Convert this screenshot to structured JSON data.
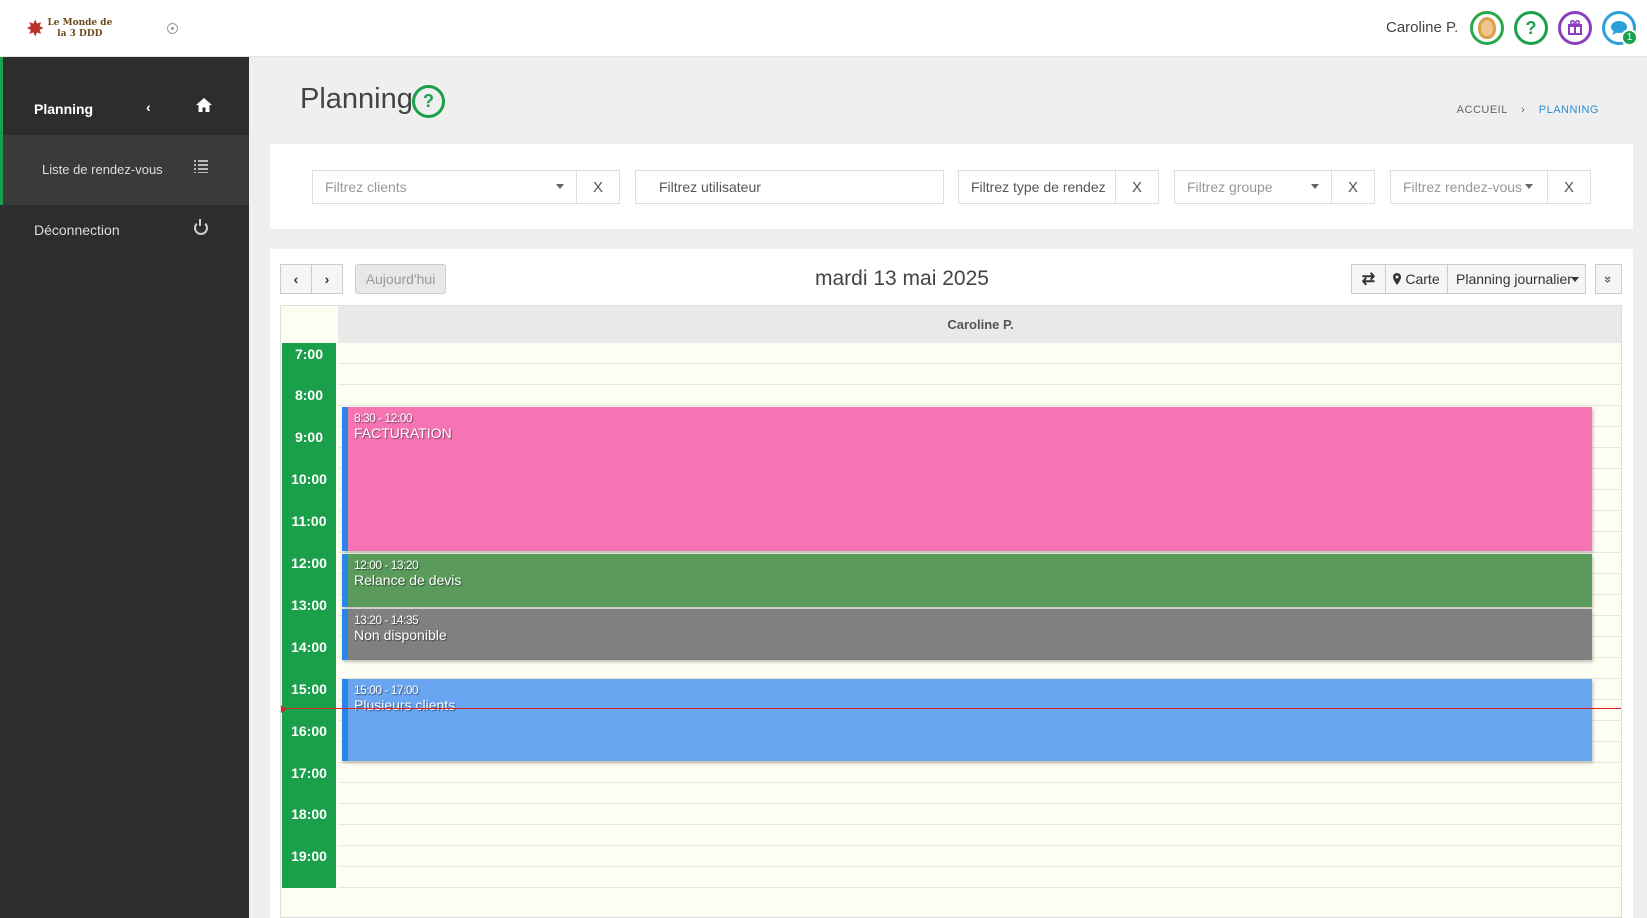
{
  "app": {
    "logo_line1": "Le Monde de",
    "logo_line2": "la 3 DDD"
  },
  "header": {
    "user_name": "Caroline P.",
    "help_glyph": "?",
    "chat_badge": "1",
    "icons": [
      "avatar",
      "help-icon",
      "gift-icon",
      "chat-icon"
    ]
  },
  "sidebar": {
    "planning_label": "Planning",
    "list_label": "Liste de rendez-vous",
    "logout_label": "Déconnection"
  },
  "page": {
    "title": "Planning",
    "help_glyph": "?",
    "breadcrumb_home": "ACCUEIL",
    "breadcrumb_sep": "›",
    "breadcrumb_current": "PLANNING"
  },
  "filters": {
    "clients_placeholder": "Filtrez clients",
    "user_placeholder": "Filtrez utilisateur",
    "type_placeholder": "Filtrez type de rendez",
    "group_placeholder": "Filtrez groupe",
    "appointments_placeholder": "Filtrez rendez-vous",
    "clear_label": "X"
  },
  "calendar": {
    "prev": "‹",
    "next": "›",
    "today_label": "Aujourd'hui",
    "date_title": "mardi 13 mai 2025",
    "swap_icon": "⇄",
    "map_label": "Carte",
    "view_label": "Planning journalier",
    "more_icon": "»",
    "column_user": "Caroline P.",
    "hours": [
      "7:00",
      "8:00",
      "9:00",
      "10:00",
      "11:00",
      "12:00",
      "13:00",
      "14:00",
      "15:00",
      "16:00",
      "17:00",
      "18:00",
      "19:00"
    ],
    "events": [
      {
        "time": "8:30 - 12:00",
        "title": "FACTURATION",
        "color": "#f674b3"
      },
      {
        "time": "12:00 - 13:20",
        "title": "Relance de devis",
        "color": "#5a9a5a"
      },
      {
        "time": "13:20 - 14:35",
        "title": "Non disponible",
        "color": "#808080"
      },
      {
        "time": "15:00 - 17:00",
        "title": "Plusieurs clients",
        "color": "#6aa5f2"
      }
    ]
  },
  "colors": {
    "accent_green": "#1aa04a",
    "sidebar_bg": "#2d2d2d",
    "now_line": "#dd2222",
    "event_border": "#2a85e8"
  }
}
